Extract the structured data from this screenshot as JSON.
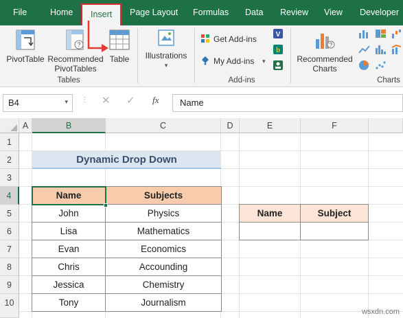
{
  "ribbon_tabs": [
    "File",
    "Home",
    "Insert",
    "Page Layout",
    "Formulas",
    "Data",
    "Review",
    "View",
    "Developer"
  ],
  "ribbon": {
    "pivot_table": "PivotTable",
    "recommended_pivot_1": "Recommended",
    "recommended_pivot_2": "PivotTables",
    "table": "Table",
    "tables_group": "Tables",
    "illustrations": "Illustrations",
    "get_addins": "Get Add-ins",
    "my_addins": "My Add-ins",
    "addins_group": "Add-ins",
    "recommended_charts_1": "Recommended",
    "recommended_charts_2": "Charts",
    "charts_group": "Charts"
  },
  "formula_bar": {
    "name_box": "B4",
    "fx_label": "fx",
    "value": "Name"
  },
  "columns": [
    "A",
    "B",
    "C",
    "D",
    "E",
    "F"
  ],
  "rows": [
    "1",
    "2",
    "3",
    "4",
    "5",
    "6",
    "7",
    "8",
    "9",
    "10"
  ],
  "sheet": {
    "title": "Dynamic Drop Down",
    "table_headers": [
      "Name",
      "Subjects"
    ],
    "table_rows": [
      [
        "John",
        "Physics"
      ],
      [
        "Lisa",
        "Mathematics"
      ],
      [
        "Evan",
        "Economics"
      ],
      [
        "Chris",
        "Accounding"
      ],
      [
        "Jessica",
        "Chemistry"
      ],
      [
        "Tony",
        "Journalism"
      ]
    ],
    "lookup_headers": [
      "Name",
      "Subject"
    ]
  },
  "watermark": "wsxdn.com",
  "colors": {
    "excel_green": "#1e7145",
    "header_fill": "#f8cbad",
    "title_fill": "#dce6f1",
    "highlight": "#d32f2f"
  }
}
